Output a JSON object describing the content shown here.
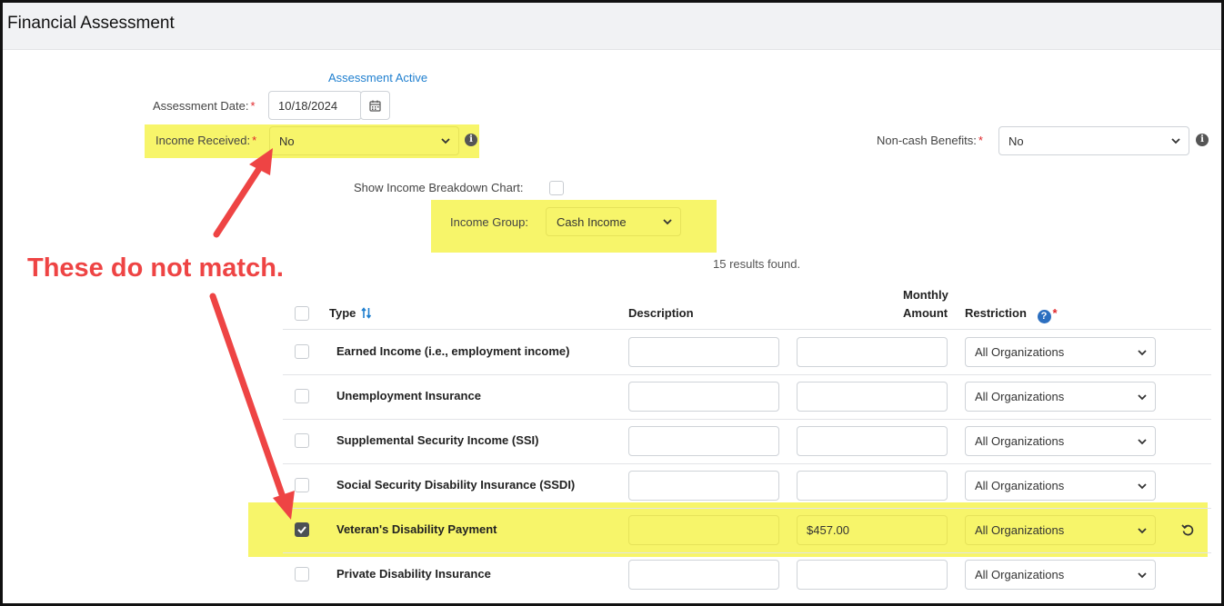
{
  "page": {
    "title": "Financial Assessment"
  },
  "assessment": {
    "status": "Assessment Active",
    "date_label": "Assessment Date:",
    "date_value": "10/18/2024",
    "income_received_label": "Income Received:",
    "income_received_value": "No",
    "noncash_label": "Non-cash Benefits:",
    "noncash_value": "No",
    "show_chart_label": "Show Income Breakdown Chart:",
    "income_group_label": "Income Group:",
    "income_group_value": "Cash Income",
    "results": "15 results found.",
    "required_mark": "*"
  },
  "annotation": {
    "text": "These do not match.",
    "color": "#ee4444"
  },
  "table": {
    "headers": {
      "type": "Type",
      "description": "Description",
      "monthly_1": "Monthly",
      "monthly_2": "Amount",
      "restriction": "Restriction"
    },
    "rows": [
      {
        "type": "Earned Income (i.e., employment income)",
        "description": "",
        "amount": "",
        "restriction": "All Organizations",
        "checked": false
      },
      {
        "type": "Unemployment Insurance",
        "description": "",
        "amount": "",
        "restriction": "All Organizations",
        "checked": false
      },
      {
        "type": "Supplemental Security Income (SSI)",
        "description": "",
        "amount": "",
        "restriction": "All Organizations",
        "checked": false
      },
      {
        "type": "Social Security Disability Insurance (SSDI)",
        "description": "",
        "amount": "",
        "restriction": "All Organizations",
        "checked": false
      },
      {
        "type": "Veteran's Disability Payment",
        "description": "",
        "amount": "$457.00",
        "restriction": "All Organizations",
        "checked": true
      },
      {
        "type": "Private Disability Insurance",
        "description": "",
        "amount": "",
        "restriction": "All Organizations",
        "checked": false
      }
    ]
  },
  "colors": {
    "highlight": "#f7f56a",
    "link": "#1f7fcf",
    "required": "#e0262a",
    "arrow": "#ee4444"
  }
}
